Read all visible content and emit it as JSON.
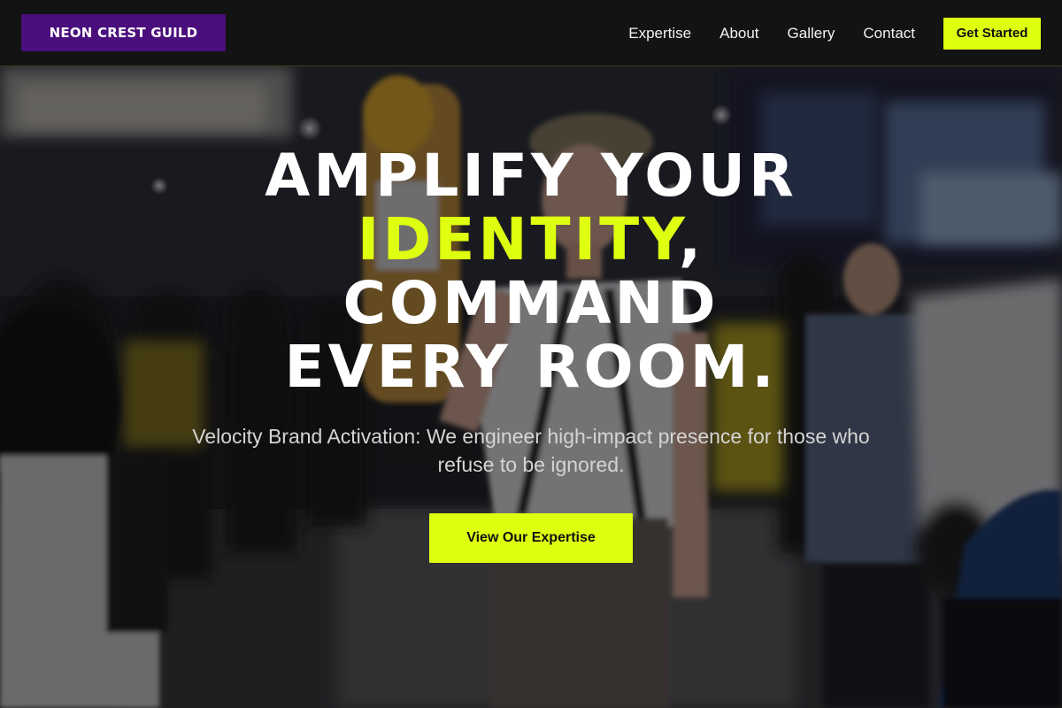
{
  "brand": {
    "name": "NEON CREST GUILD",
    "bg_color": "#4a0f7d"
  },
  "nav": {
    "links": [
      "Expertise",
      "About",
      "Gallery",
      "Contact"
    ],
    "cta_label": "Get Started"
  },
  "hero": {
    "background_image": "blurred-expo-crowd-photo",
    "headline": {
      "line1": "AMPLIFY YOUR",
      "line2_accent": "IDENTITY",
      "line2_rest": ",",
      "line3": "COMMAND",
      "line4": "EVERY ROOM."
    },
    "subtitle": "Velocity Brand Activation: We engineer high-impact presence for those who refuse to be ignored.",
    "cta_label": "View Our Expertise"
  },
  "colors": {
    "accent": "#dfff11",
    "nav_bg": "#131313",
    "text": "#ffffff"
  }
}
